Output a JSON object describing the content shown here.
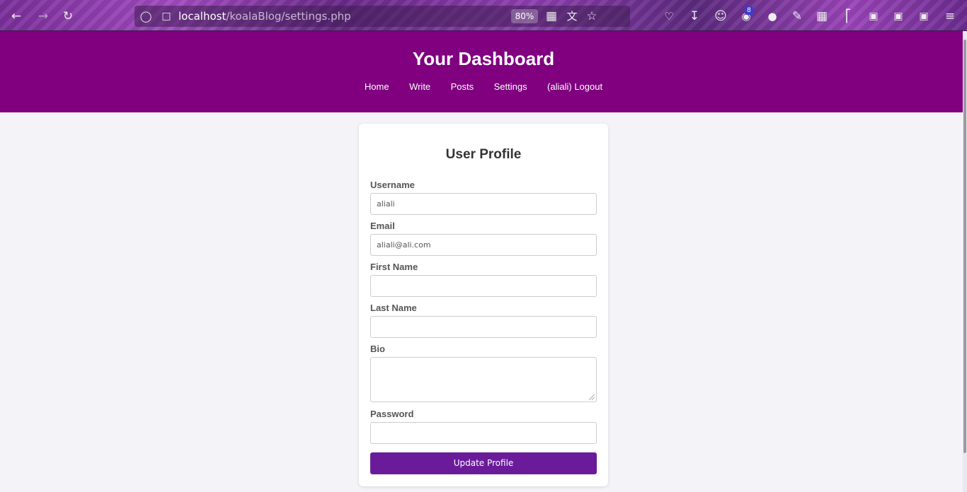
{
  "browser": {
    "url_host": "localhost",
    "url_path": "/koalaBlog/settings.php",
    "zoom": "80%",
    "badges": {
      "extension_count": "8"
    }
  },
  "header": {
    "title": "Your Dashboard",
    "nav": [
      "Home",
      "Write",
      "Posts",
      "Settings",
      "(aliali) Logout"
    ]
  },
  "form": {
    "title": "User Profile",
    "username_label": "Username",
    "username_value": "aliali",
    "email_label": "Email",
    "email_value": "aliali@ali.com",
    "first_name_label": "First Name",
    "first_name_value": "",
    "last_name_label": "Last Name",
    "last_name_value": "",
    "bio_label": "Bio",
    "bio_value": "",
    "password_label": "Password",
    "password_value": "",
    "submit_label": "Update Profile"
  },
  "colors": {
    "header_bg": "#800080",
    "button_bg": "#6a1b9a",
    "page_bg": "#f4f4f8"
  }
}
